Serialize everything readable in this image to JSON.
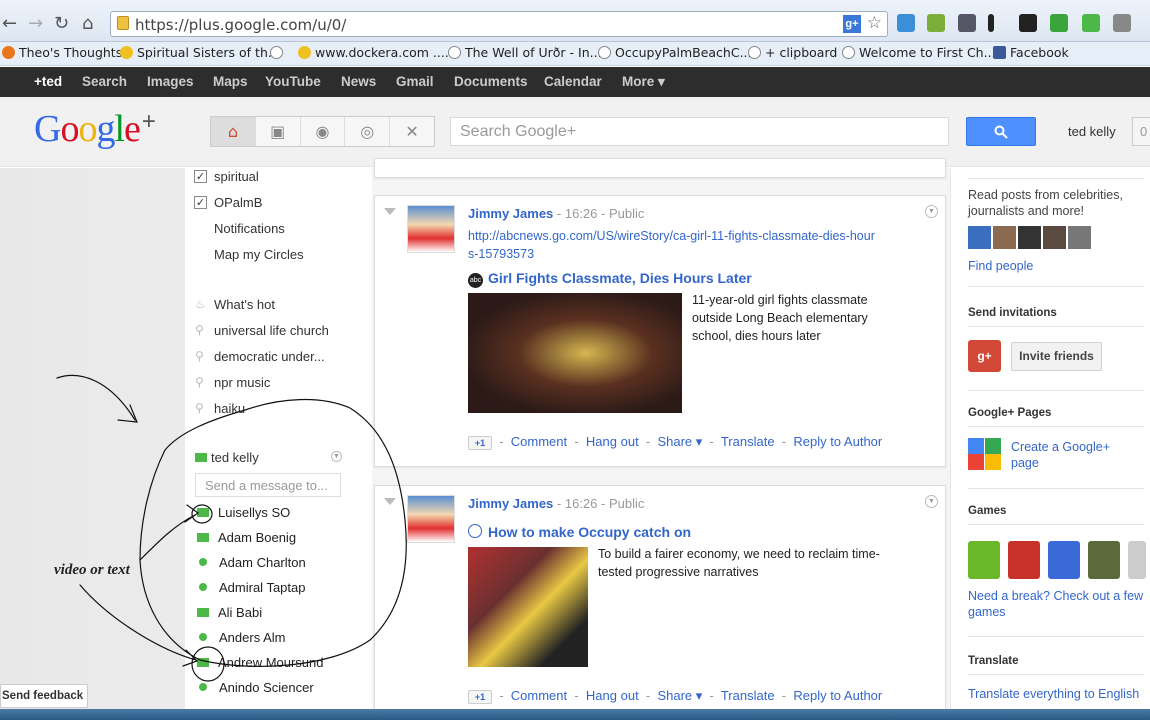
{
  "browser": {
    "url": "https://plus.google.com/u/0/",
    "bookmarks": [
      {
        "label": "Theo's Thoughts",
        "icon_color": "#e8761c"
      },
      {
        "label": "Spiritual Sisters of th...",
        "icon_color": "#f0c020"
      },
      {
        "label": "",
        "icon_color": "#888888"
      },
      {
        "label": "www.dockera.com .....",
        "icon_color": "#f0c020"
      },
      {
        "label": "The Well of Urðr - In...",
        "icon_color": "#888888"
      },
      {
        "label": "OccupyPalmBeachC...",
        "icon_color": "#888888"
      },
      {
        "label": "+ clipboard",
        "icon_color": "#888888"
      },
      {
        "label": "Welcome to First Ch...",
        "icon_color": "#888888"
      },
      {
        "label": "Facebook",
        "icon_color": "#3b5998"
      }
    ]
  },
  "gbar": {
    "items": [
      "+ted",
      "Search",
      "Images",
      "Maps",
      "YouTube",
      "News",
      "Gmail",
      "Documents",
      "Calendar",
      "More ▾"
    ]
  },
  "header": {
    "logo": "Google",
    "logo_plus": "+",
    "search_placeholder": "Search Google+",
    "user_name": "ted kelly",
    "notification_count": "0",
    "nav_icons": [
      "home-icon",
      "photos-icon",
      "profile-icon",
      "circles-icon",
      "games-icon"
    ]
  },
  "leftnav": {
    "streams": [
      {
        "label": "spiritual",
        "checked": true
      },
      {
        "label": "OPalmB",
        "checked": true
      },
      {
        "label": "Notifications",
        "checked": false
      },
      {
        "label": "Map my Circles",
        "checked": false
      }
    ],
    "whats_hot": "What's hot",
    "saved_searches": [
      "universal life church",
      "democratic under...",
      "npr music",
      "haiku"
    ],
    "chat": {
      "user": "ted kelly",
      "message_placeholder": "Send a message to...",
      "contacts": [
        {
          "name": "Luisellys SO",
          "status": "video"
        },
        {
          "name": "Adam Boenig",
          "status": "video"
        },
        {
          "name": "Adam Charlton",
          "status": "online"
        },
        {
          "name": "Admiral Taptap",
          "status": "online"
        },
        {
          "name": "Ali Babi",
          "status": "video"
        },
        {
          "name": "Anders Alm",
          "status": "online"
        },
        {
          "name": "Andrew Moursund",
          "status": "video"
        },
        {
          "name": "Anindo Sciencer",
          "status": "online"
        }
      ]
    }
  },
  "posts": [
    {
      "author": "Jimmy James",
      "time": "16:26",
      "visibility": "Public",
      "link": "http://abcnews.go.com/US/wireStory/ca-girl-11-fights-classmate-dies-hours-15793573",
      "title": "Girl Fights Classmate, Dies Hours Later",
      "source_badge": "abc",
      "description": "11-year-old girl fights classmate outside Long Beach elementary school, dies hours later",
      "actions": {
        "plus_one": "+1",
        "comment": "Comment",
        "hangout": "Hang out",
        "share": "Share ▾",
        "translate": "Translate",
        "reply": "Reply to Author"
      }
    },
    {
      "author": "Jimmy James",
      "time": "16:26",
      "visibility": "Public",
      "title": "How to make Occupy catch on",
      "description": "To build a fairer economy, we need to reclaim time-tested progressive narratives",
      "actions": {
        "plus_one": "+1",
        "comment": "Comment",
        "hangout": "Hang out",
        "share": "Share ▾",
        "translate": "Translate",
        "reply": "Reply to Author"
      }
    }
  ],
  "rail": {
    "suggest_text": "Read posts from celebrities, journalists and more!",
    "find_people": "Find people",
    "invitations_head": "Send invitations",
    "invite_button": "Invite friends",
    "pages_head": "Google+ Pages",
    "create_page": "Create a Google+ page",
    "games_head": "Games",
    "games_link": "Need a break? Check out a few games",
    "translate_head": "Translate",
    "translate_link": "Translate everything to English"
  },
  "footer": {
    "feedback": "Send feedback"
  },
  "annotation": {
    "label": "video or text"
  }
}
